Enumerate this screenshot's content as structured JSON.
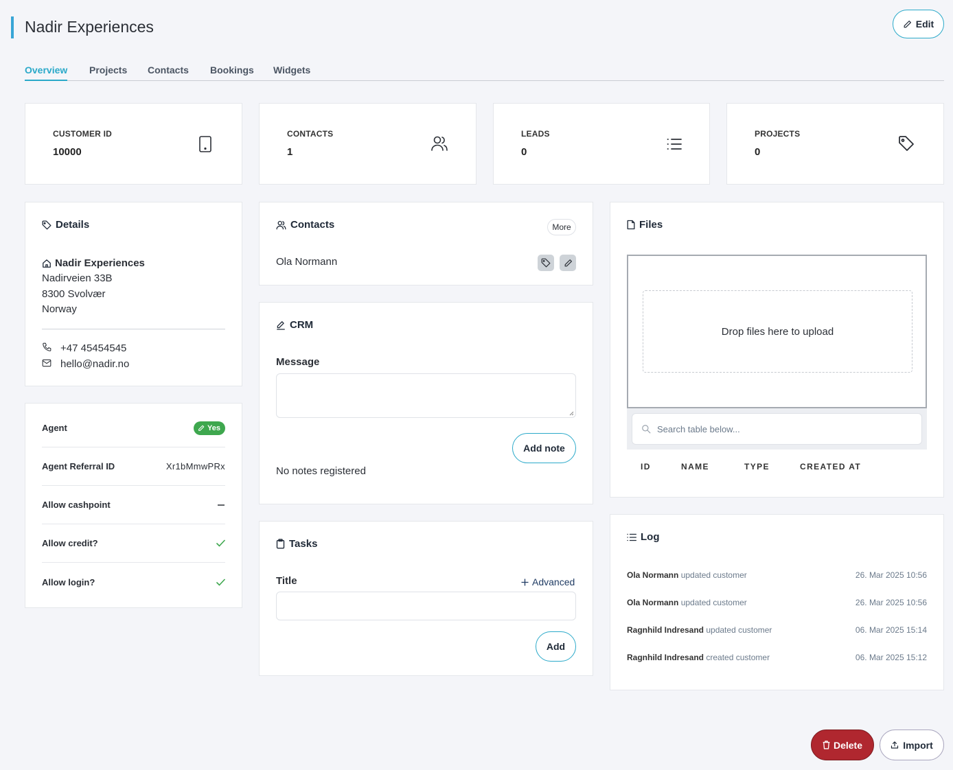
{
  "header": {
    "title": "Nadir Experiences",
    "edit_label": "Edit"
  },
  "tabs": [
    "Overview",
    "Projects",
    "Contacts",
    "Bookings",
    "Widgets"
  ],
  "stats": [
    {
      "label": "CUSTOMER ID",
      "value": "10000",
      "icon": "tablet-icon"
    },
    {
      "label": "CONTACTS",
      "value": "1",
      "icon": "users-icon"
    },
    {
      "label": "LEADS",
      "value": "0",
      "icon": "list-icon"
    },
    {
      "label": "PROJECTS",
      "value": "0",
      "icon": "tag-icon"
    }
  ],
  "details": {
    "title": "Details",
    "company": "Nadir Experiences",
    "address_lines": [
      "Nadirveien 33B",
      "8300 Svolvær",
      "Norway"
    ],
    "phone": "+47 45454545",
    "email": "hello@nadir.no"
  },
  "settings": {
    "agent_label": "Agent",
    "agent_badge": "Yes",
    "referral_label": "Agent Referral ID",
    "referral_value": "Xr1bMmwPRx",
    "cashpoint_label": "Allow cashpoint",
    "credit_label": "Allow credit?",
    "login_label": "Allow login?"
  },
  "contacts": {
    "title": "Contacts",
    "more_label": "More",
    "items": [
      "Ola Normann"
    ]
  },
  "crm": {
    "title": "CRM",
    "message_label": "Message",
    "add_note_label": "Add note",
    "empty_text": "No notes registered"
  },
  "tasks": {
    "title": "Tasks",
    "title_label": "Title",
    "advanced_label": "Advanced",
    "add_label": "Add"
  },
  "files": {
    "title": "Files",
    "drop_text": "Drop files here to upload",
    "search_placeholder": "Search table below...",
    "columns": [
      "ID",
      "NAME",
      "TYPE",
      "CREATED AT"
    ]
  },
  "log": {
    "title": "Log",
    "entries": [
      {
        "user": "Ola Normann",
        "action": "updated customer",
        "date": "26. Mar 2025 10:56"
      },
      {
        "user": "Ola Normann",
        "action": "updated customer",
        "date": "26. Mar 2025 10:56"
      },
      {
        "user": "Ragnhild Indresand",
        "action": "updated customer",
        "date": "06. Mar 2025 15:14"
      },
      {
        "user": "Ragnhild Indresand",
        "action": "created customer",
        "date": "06. Mar 2025 15:12"
      }
    ]
  },
  "footer": {
    "delete_label": "Delete",
    "import_label": "Import"
  },
  "colors": {
    "accent": "#2aa9c9",
    "danger": "#b0272f",
    "success": "#3ea74e",
    "background": "#f4f5f9"
  }
}
